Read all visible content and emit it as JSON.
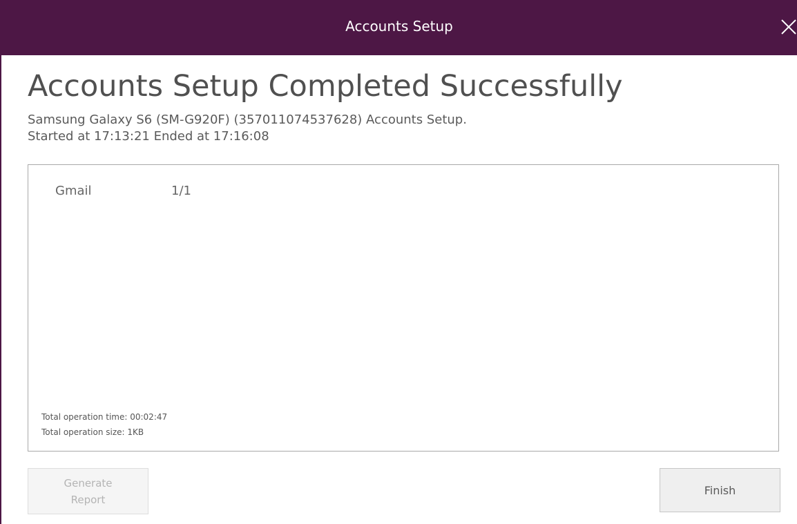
{
  "window": {
    "title": "Accounts Setup",
    "title_bar_color": "#4d1745"
  },
  "main": {
    "heading": "Accounts Setup Completed Successfully",
    "subtitle_line1": "Samsung Galaxy S6 (SM-G920F) (357011074537628) Accounts Setup.",
    "subtitle_line2": "Started at 17:13:21 Ended at 17:16:08"
  },
  "results": {
    "rows": [
      {
        "account": "Gmail",
        "count": "1/1"
      }
    ],
    "total_time": "Total operation time: 00:02:47",
    "total_size": "Total operation size: 1KB"
  },
  "buttons": {
    "generate_report": "Generate Report",
    "finish": "Finish"
  },
  "icons": {
    "close": "close-icon"
  }
}
